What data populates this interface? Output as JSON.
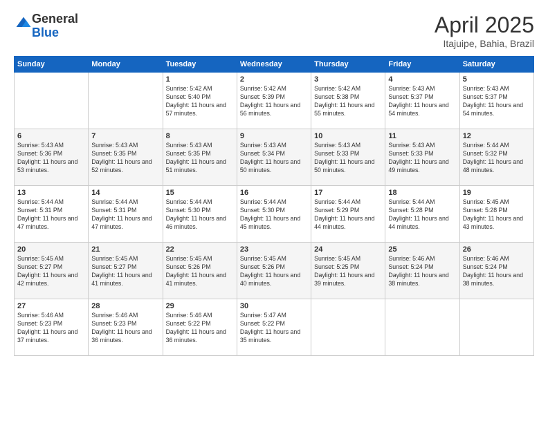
{
  "logo": {
    "general": "General",
    "blue": "Blue"
  },
  "title": "April 2025",
  "location": "Itajuipe, Bahia, Brazil",
  "days_of_week": [
    "Sunday",
    "Monday",
    "Tuesday",
    "Wednesday",
    "Thursday",
    "Friday",
    "Saturday"
  ],
  "weeks": [
    [
      {
        "day": "",
        "info": ""
      },
      {
        "day": "",
        "info": ""
      },
      {
        "day": "1",
        "info": "Sunrise: 5:42 AM\nSunset: 5:40 PM\nDaylight: 11 hours and 57 minutes."
      },
      {
        "day": "2",
        "info": "Sunrise: 5:42 AM\nSunset: 5:39 PM\nDaylight: 11 hours and 56 minutes."
      },
      {
        "day": "3",
        "info": "Sunrise: 5:42 AM\nSunset: 5:38 PM\nDaylight: 11 hours and 55 minutes."
      },
      {
        "day": "4",
        "info": "Sunrise: 5:43 AM\nSunset: 5:37 PM\nDaylight: 11 hours and 54 minutes."
      },
      {
        "day": "5",
        "info": "Sunrise: 5:43 AM\nSunset: 5:37 PM\nDaylight: 11 hours and 54 minutes."
      }
    ],
    [
      {
        "day": "6",
        "info": "Sunrise: 5:43 AM\nSunset: 5:36 PM\nDaylight: 11 hours and 53 minutes."
      },
      {
        "day": "7",
        "info": "Sunrise: 5:43 AM\nSunset: 5:35 PM\nDaylight: 11 hours and 52 minutes."
      },
      {
        "day": "8",
        "info": "Sunrise: 5:43 AM\nSunset: 5:35 PM\nDaylight: 11 hours and 51 minutes."
      },
      {
        "day": "9",
        "info": "Sunrise: 5:43 AM\nSunset: 5:34 PM\nDaylight: 11 hours and 50 minutes."
      },
      {
        "day": "10",
        "info": "Sunrise: 5:43 AM\nSunset: 5:33 PM\nDaylight: 11 hours and 50 minutes."
      },
      {
        "day": "11",
        "info": "Sunrise: 5:43 AM\nSunset: 5:33 PM\nDaylight: 11 hours and 49 minutes."
      },
      {
        "day": "12",
        "info": "Sunrise: 5:44 AM\nSunset: 5:32 PM\nDaylight: 11 hours and 48 minutes."
      }
    ],
    [
      {
        "day": "13",
        "info": "Sunrise: 5:44 AM\nSunset: 5:31 PM\nDaylight: 11 hours and 47 minutes."
      },
      {
        "day": "14",
        "info": "Sunrise: 5:44 AM\nSunset: 5:31 PM\nDaylight: 11 hours and 47 minutes."
      },
      {
        "day": "15",
        "info": "Sunrise: 5:44 AM\nSunset: 5:30 PM\nDaylight: 11 hours and 46 minutes."
      },
      {
        "day": "16",
        "info": "Sunrise: 5:44 AM\nSunset: 5:30 PM\nDaylight: 11 hours and 45 minutes."
      },
      {
        "day": "17",
        "info": "Sunrise: 5:44 AM\nSunset: 5:29 PM\nDaylight: 11 hours and 44 minutes."
      },
      {
        "day": "18",
        "info": "Sunrise: 5:44 AM\nSunset: 5:28 PM\nDaylight: 11 hours and 44 minutes."
      },
      {
        "day": "19",
        "info": "Sunrise: 5:45 AM\nSunset: 5:28 PM\nDaylight: 11 hours and 43 minutes."
      }
    ],
    [
      {
        "day": "20",
        "info": "Sunrise: 5:45 AM\nSunset: 5:27 PM\nDaylight: 11 hours and 42 minutes."
      },
      {
        "day": "21",
        "info": "Sunrise: 5:45 AM\nSunset: 5:27 PM\nDaylight: 11 hours and 41 minutes."
      },
      {
        "day": "22",
        "info": "Sunrise: 5:45 AM\nSunset: 5:26 PM\nDaylight: 11 hours and 41 minutes."
      },
      {
        "day": "23",
        "info": "Sunrise: 5:45 AM\nSunset: 5:26 PM\nDaylight: 11 hours and 40 minutes."
      },
      {
        "day": "24",
        "info": "Sunrise: 5:45 AM\nSunset: 5:25 PM\nDaylight: 11 hours and 39 minutes."
      },
      {
        "day": "25",
        "info": "Sunrise: 5:46 AM\nSunset: 5:24 PM\nDaylight: 11 hours and 38 minutes."
      },
      {
        "day": "26",
        "info": "Sunrise: 5:46 AM\nSunset: 5:24 PM\nDaylight: 11 hours and 38 minutes."
      }
    ],
    [
      {
        "day": "27",
        "info": "Sunrise: 5:46 AM\nSunset: 5:23 PM\nDaylight: 11 hours and 37 minutes."
      },
      {
        "day": "28",
        "info": "Sunrise: 5:46 AM\nSunset: 5:23 PM\nDaylight: 11 hours and 36 minutes."
      },
      {
        "day": "29",
        "info": "Sunrise: 5:46 AM\nSunset: 5:22 PM\nDaylight: 11 hours and 36 minutes."
      },
      {
        "day": "30",
        "info": "Sunrise: 5:47 AM\nSunset: 5:22 PM\nDaylight: 11 hours and 35 minutes."
      },
      {
        "day": "",
        "info": ""
      },
      {
        "day": "",
        "info": ""
      },
      {
        "day": "",
        "info": ""
      }
    ]
  ]
}
